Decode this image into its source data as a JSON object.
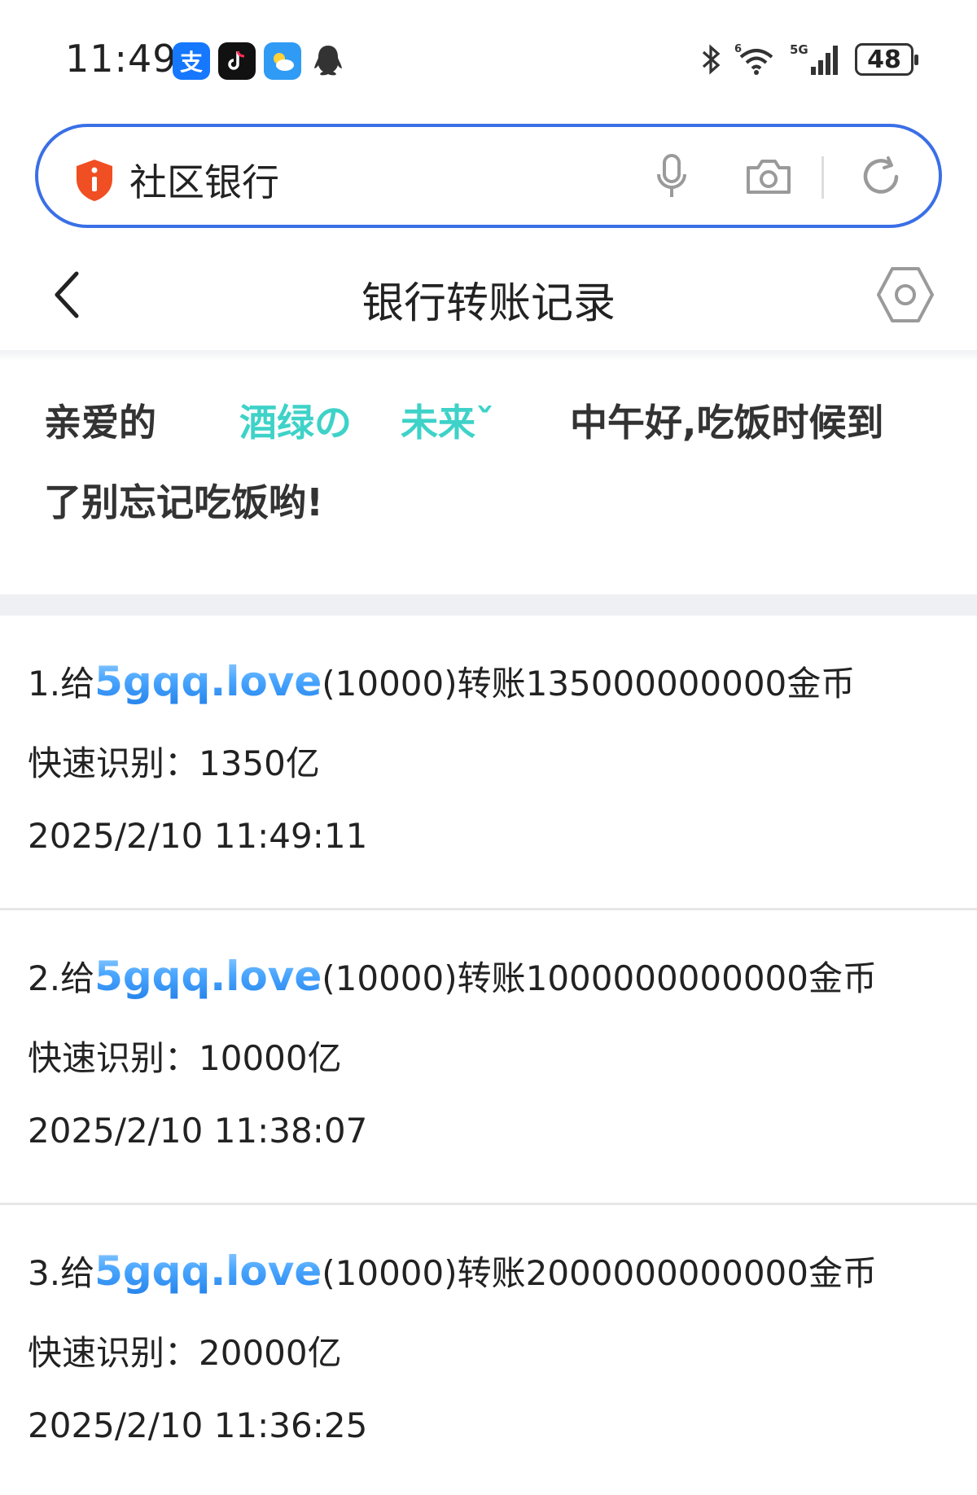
{
  "status_bar": {
    "time": "11:49",
    "alipay_glyph": "支",
    "battery": "48",
    "icons": [
      "alipay-icon",
      "tiktok-icon",
      "weather-icon",
      "qq-icon",
      "bluetooth-icon",
      "wifi-icon",
      "signal-5g-icon",
      "battery-icon"
    ]
  },
  "search": {
    "text": "社区银行",
    "icons": [
      "shield-warning-icon",
      "microphone-icon",
      "camera-icon",
      "refresh-icon"
    ]
  },
  "header": {
    "title": "银行转账记录",
    "icons": [
      "back-chevron-icon",
      "settings-hexagon-icon"
    ]
  },
  "greeting": {
    "prefix": "亲爱的",
    "name_part1": "酒绿の",
    "name_part2": "未来ˇ",
    "suffix_line1": "中午好,吃饭时候到",
    "line2": "了别忘记吃饭哟!"
  },
  "records": [
    {
      "index": "1.给",
      "recipient": "5gqq.love",
      "detail": "(10000)转账135000000000金币",
      "quick_label": "快速识别：",
      "quick_value": "1350亿",
      "datetime": "2025/2/10 11:49:11"
    },
    {
      "index": "2.给",
      "recipient": "5gqq.love",
      "detail": "(10000)转账1000000000000金币",
      "quick_label": "快速识别：",
      "quick_value": "10000亿",
      "datetime": "2025/2/10 11:38:07"
    },
    {
      "index": "3.给",
      "recipient": "5gqq.love",
      "detail": "(10000)转账2000000000000金币",
      "quick_label": "快速识别：",
      "quick_value": "20000亿",
      "datetime": "2025/2/10 11:36:25"
    }
  ],
  "colors": {
    "search_border": "#3a6fe6",
    "name_teal": "#3ed2c8",
    "recipient_blue": "#1f7fe8",
    "shield_orange": "#f04e23"
  }
}
